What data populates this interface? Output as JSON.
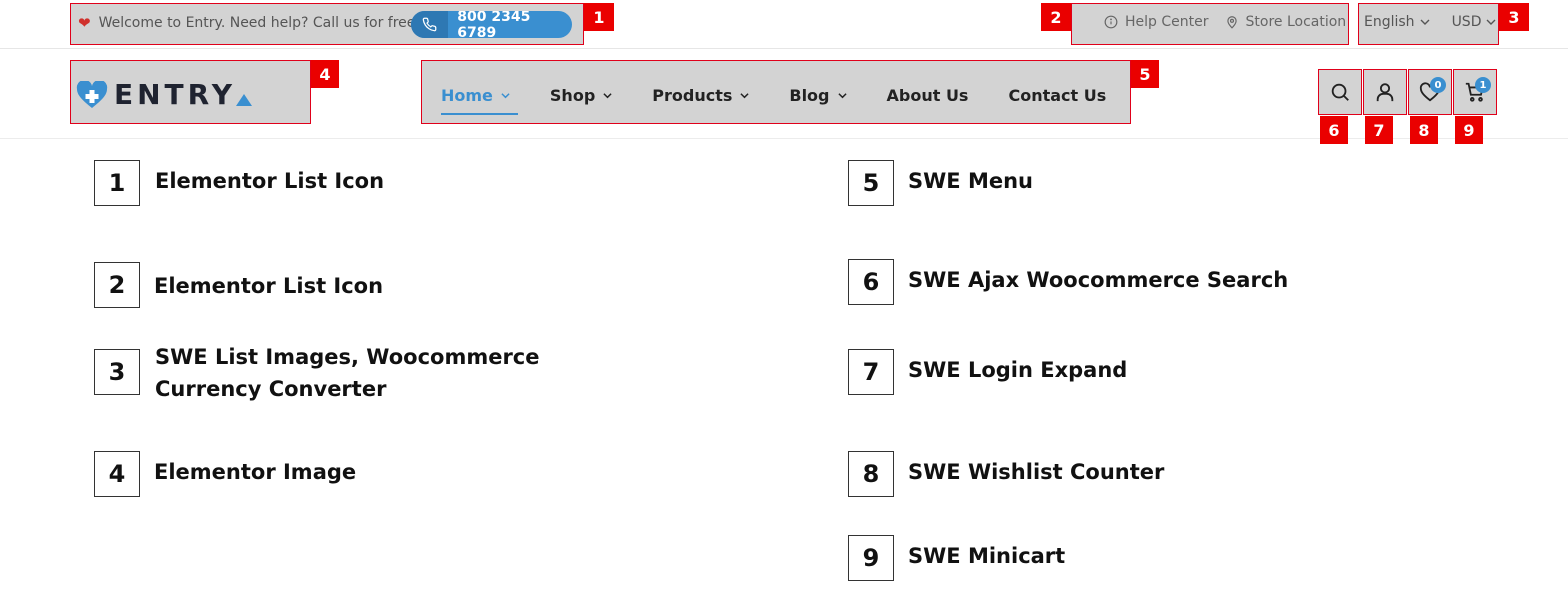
{
  "topbar": {
    "welcome_text": "Welcome to Entry. Need help? Call us for free",
    "phone_number": "800 2345 6789",
    "help_center": "Help Center",
    "store_location": "Store Location",
    "language": "English",
    "currency": "USD"
  },
  "logo": {
    "text": "ENTRY"
  },
  "nav": {
    "items": [
      {
        "label": "Home",
        "has_dropdown": true,
        "active": true
      },
      {
        "label": "Shop",
        "has_dropdown": true
      },
      {
        "label": "Products",
        "has_dropdown": true
      },
      {
        "label": "Blog",
        "has_dropdown": true
      },
      {
        "label": "About Us",
        "has_dropdown": false
      },
      {
        "label": "Contact Us",
        "has_dropdown": false
      }
    ]
  },
  "header_icons": {
    "wishlist_count": "0",
    "cart_count": "1"
  },
  "markers": [
    "1",
    "2",
    "3",
    "4",
    "5",
    "6",
    "7",
    "8",
    "9"
  ],
  "legend": [
    {
      "num": "1",
      "label": "Elementor List Icon"
    },
    {
      "num": "2",
      "label": "Elementor List Icon"
    },
    {
      "num": "3",
      "label_line1": "SWE List Images, Woocommerce",
      "label_line2": "Currency Converter"
    },
    {
      "num": "4",
      "label": "Elementor Image"
    },
    {
      "num": "5",
      "label": "SWE Menu"
    },
    {
      "num": "6",
      "label": "SWE Ajax Woocommerce Search"
    },
    {
      "num": "7",
      "label": "SWE Login Expand"
    },
    {
      "num": "8",
      "label": "SWE Wishlist Counter"
    },
    {
      "num": "9",
      "label": "SWE Minicart"
    }
  ],
  "colors": {
    "accent": "#3a8fd0",
    "marker": "#ea0000",
    "highlight": "#d3d3d3"
  }
}
